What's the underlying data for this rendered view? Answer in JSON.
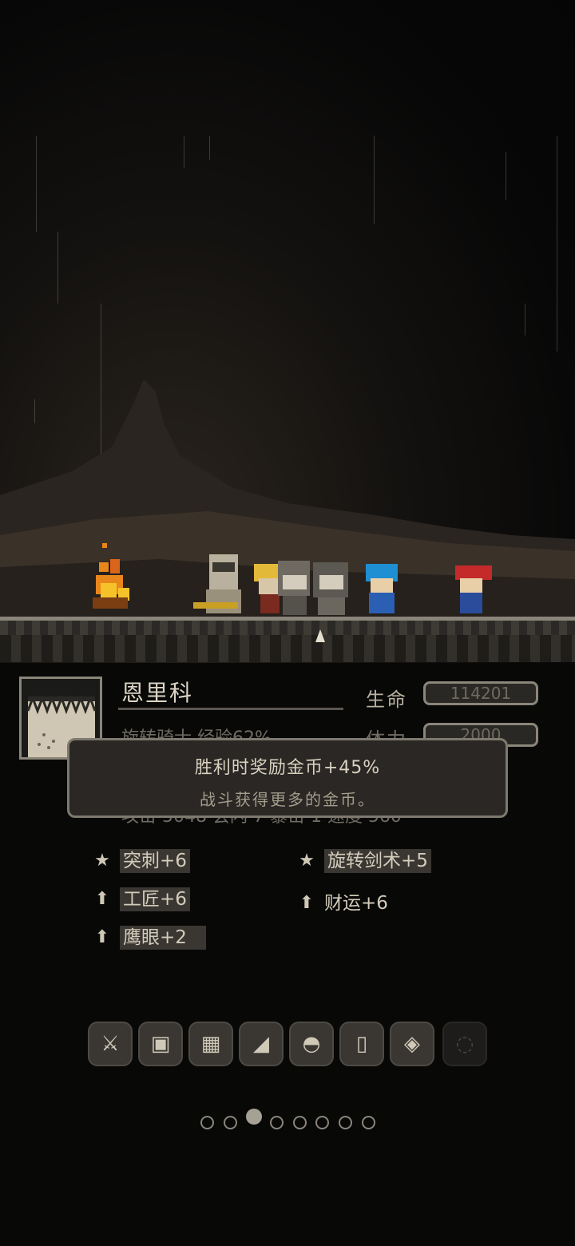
{
  "hero": {
    "name": "恩里科",
    "subtitle": "旋转骑士  经验62%",
    "hidden_line": "攻击 5048 会闪 7 暴击 1 速度 560"
  },
  "stats": {
    "hp_label": "生命",
    "hp_value": "114201",
    "stamina_label": "体力",
    "stamina_value": "2000"
  },
  "tooltip": {
    "title": "胜利时奖励金币+45%",
    "desc": "战斗获得更多的金币。"
  },
  "skills": [
    {
      "icon": "star-icon",
      "label": "突刺+6"
    },
    {
      "icon": "star-icon",
      "label": "旋转剑术+5"
    },
    {
      "icon": "up-arrow-icon",
      "label": "工匠+6"
    },
    {
      "icon": "up-arrow-icon",
      "label": "财运+6"
    },
    {
      "icon": "up-arrow-icon",
      "label": "鹰眼+2"
    }
  ],
  "equipment_slots": [
    {
      "icon": "sword-icon",
      "glyph": "⚔"
    },
    {
      "icon": "armor-icon",
      "glyph": "▣"
    },
    {
      "icon": "chestplate-icon",
      "glyph": "▦"
    },
    {
      "icon": "boots-icon",
      "glyph": "◢"
    },
    {
      "icon": "helmet-icon",
      "glyph": "◓"
    },
    {
      "icon": "shield-icon",
      "glyph": "▯"
    },
    {
      "icon": "ring-icon",
      "glyph": "◈"
    },
    {
      "icon": "locked-slot-icon",
      "glyph": "◌"
    }
  ],
  "pagination": {
    "total": 8,
    "active_index": 2
  },
  "colors": {
    "accent": "#8b867a",
    "panel": "#2a2724",
    "fire": "#e8861c"
  }
}
